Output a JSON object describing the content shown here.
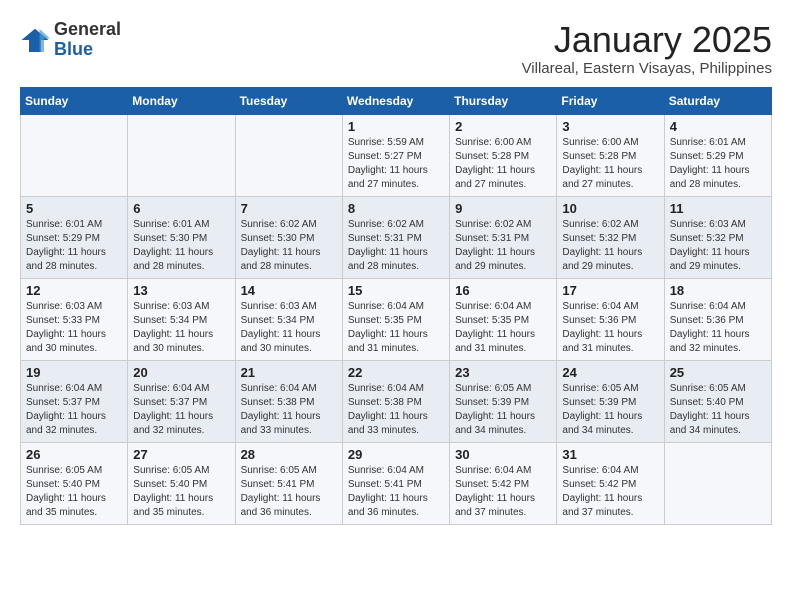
{
  "logo": {
    "line1": "General",
    "line2": "Blue"
  },
  "header": {
    "title": "January 2025",
    "subtitle": "Villareal, Eastern Visayas, Philippines"
  },
  "columns": [
    "Sunday",
    "Monday",
    "Tuesday",
    "Wednesday",
    "Thursday",
    "Friday",
    "Saturday"
  ],
  "weeks": [
    [
      {
        "day": "",
        "info": ""
      },
      {
        "day": "",
        "info": ""
      },
      {
        "day": "",
        "info": ""
      },
      {
        "day": "1",
        "info": "Sunrise: 5:59 AM\nSunset: 5:27 PM\nDaylight: 11 hours\nand 27 minutes."
      },
      {
        "day": "2",
        "info": "Sunrise: 6:00 AM\nSunset: 5:28 PM\nDaylight: 11 hours\nand 27 minutes."
      },
      {
        "day": "3",
        "info": "Sunrise: 6:00 AM\nSunset: 5:28 PM\nDaylight: 11 hours\nand 27 minutes."
      },
      {
        "day": "4",
        "info": "Sunrise: 6:01 AM\nSunset: 5:29 PM\nDaylight: 11 hours\nand 28 minutes."
      }
    ],
    [
      {
        "day": "5",
        "info": "Sunrise: 6:01 AM\nSunset: 5:29 PM\nDaylight: 11 hours\nand 28 minutes."
      },
      {
        "day": "6",
        "info": "Sunrise: 6:01 AM\nSunset: 5:30 PM\nDaylight: 11 hours\nand 28 minutes."
      },
      {
        "day": "7",
        "info": "Sunrise: 6:02 AM\nSunset: 5:30 PM\nDaylight: 11 hours\nand 28 minutes."
      },
      {
        "day": "8",
        "info": "Sunrise: 6:02 AM\nSunset: 5:31 PM\nDaylight: 11 hours\nand 28 minutes."
      },
      {
        "day": "9",
        "info": "Sunrise: 6:02 AM\nSunset: 5:31 PM\nDaylight: 11 hours\nand 29 minutes."
      },
      {
        "day": "10",
        "info": "Sunrise: 6:02 AM\nSunset: 5:32 PM\nDaylight: 11 hours\nand 29 minutes."
      },
      {
        "day": "11",
        "info": "Sunrise: 6:03 AM\nSunset: 5:32 PM\nDaylight: 11 hours\nand 29 minutes."
      }
    ],
    [
      {
        "day": "12",
        "info": "Sunrise: 6:03 AM\nSunset: 5:33 PM\nDaylight: 11 hours\nand 30 minutes."
      },
      {
        "day": "13",
        "info": "Sunrise: 6:03 AM\nSunset: 5:34 PM\nDaylight: 11 hours\nand 30 minutes."
      },
      {
        "day": "14",
        "info": "Sunrise: 6:03 AM\nSunset: 5:34 PM\nDaylight: 11 hours\nand 30 minutes."
      },
      {
        "day": "15",
        "info": "Sunrise: 6:04 AM\nSunset: 5:35 PM\nDaylight: 11 hours\nand 31 minutes."
      },
      {
        "day": "16",
        "info": "Sunrise: 6:04 AM\nSunset: 5:35 PM\nDaylight: 11 hours\nand 31 minutes."
      },
      {
        "day": "17",
        "info": "Sunrise: 6:04 AM\nSunset: 5:36 PM\nDaylight: 11 hours\nand 31 minutes."
      },
      {
        "day": "18",
        "info": "Sunrise: 6:04 AM\nSunset: 5:36 PM\nDaylight: 11 hours\nand 32 minutes."
      }
    ],
    [
      {
        "day": "19",
        "info": "Sunrise: 6:04 AM\nSunset: 5:37 PM\nDaylight: 11 hours\nand 32 minutes."
      },
      {
        "day": "20",
        "info": "Sunrise: 6:04 AM\nSunset: 5:37 PM\nDaylight: 11 hours\nand 32 minutes."
      },
      {
        "day": "21",
        "info": "Sunrise: 6:04 AM\nSunset: 5:38 PM\nDaylight: 11 hours\nand 33 minutes."
      },
      {
        "day": "22",
        "info": "Sunrise: 6:04 AM\nSunset: 5:38 PM\nDaylight: 11 hours\nand 33 minutes."
      },
      {
        "day": "23",
        "info": "Sunrise: 6:05 AM\nSunset: 5:39 PM\nDaylight: 11 hours\nand 34 minutes."
      },
      {
        "day": "24",
        "info": "Sunrise: 6:05 AM\nSunset: 5:39 PM\nDaylight: 11 hours\nand 34 minutes."
      },
      {
        "day": "25",
        "info": "Sunrise: 6:05 AM\nSunset: 5:40 PM\nDaylight: 11 hours\nand 34 minutes."
      }
    ],
    [
      {
        "day": "26",
        "info": "Sunrise: 6:05 AM\nSunset: 5:40 PM\nDaylight: 11 hours\nand 35 minutes."
      },
      {
        "day": "27",
        "info": "Sunrise: 6:05 AM\nSunset: 5:40 PM\nDaylight: 11 hours\nand 35 minutes."
      },
      {
        "day": "28",
        "info": "Sunrise: 6:05 AM\nSunset: 5:41 PM\nDaylight: 11 hours\nand 36 minutes."
      },
      {
        "day": "29",
        "info": "Sunrise: 6:04 AM\nSunset: 5:41 PM\nDaylight: 11 hours\nand 36 minutes."
      },
      {
        "day": "30",
        "info": "Sunrise: 6:04 AM\nSunset: 5:42 PM\nDaylight: 11 hours\nand 37 minutes."
      },
      {
        "day": "31",
        "info": "Sunrise: 6:04 AM\nSunset: 5:42 PM\nDaylight: 11 hours\nand 37 minutes."
      },
      {
        "day": "",
        "info": ""
      }
    ]
  ]
}
